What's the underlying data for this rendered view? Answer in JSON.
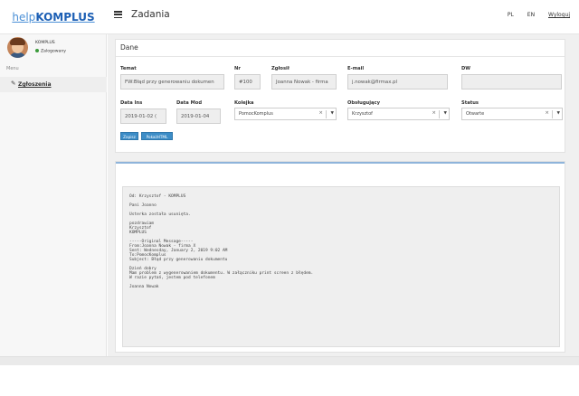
{
  "header": {
    "logo_part1": "help",
    "logo_part2": "KOMPLUS",
    "title": "Zadania",
    "lang_pl": "PL",
    "lang_en": "EN",
    "logout": "Wyloguj"
  },
  "sidebar": {
    "user_name": "KOMPLUS",
    "user_status": "Zalogowany",
    "menu_header": "Menu",
    "items": [
      {
        "label": "Zgłoszenia",
        "icon": "edit-icon"
      }
    ]
  },
  "form": {
    "panel_title": "Dane",
    "temat_label": "Temat",
    "temat_value": "FW:Błąd przy generowaniu dokumen",
    "nr_label": "Nr",
    "nr_value": "#100",
    "zglosil_label": "Zgłosił",
    "zglosil_value": "Joanna Nowak - firma",
    "email_label": "E-mail",
    "email_value": "j.nowak@firmax.pl",
    "dw_label": "DW",
    "dw_value": "",
    "data_ins_label": "Data Ins",
    "data_ins_value": "2019-01-02 (",
    "data_mod_label": "Data Mod",
    "data_mod_value": "2019-01-04",
    "kolejka_label": "Kolejka",
    "kolejka_value": "PomocKomplus",
    "obslugujacy_label": "Obsługujący",
    "obslugujacy_value": "Krzysztof",
    "status_label": "Status",
    "status_value": "Otwarte",
    "save_button": "Zapisz",
    "html_button": "PokażHTML"
  },
  "message": {
    "lines": [
      "Od: Krzysztof - KOMPLUS",
      "",
      "Pani Joanno",
      "",
      "Usterka została usunięta.",
      "",
      "pozdrawiam",
      "Krzysztof",
      "KOMPLUS",
      "",
      "-----Original Message-----",
      "From:Joanna Nowak - firma X",
      "Sent: Wednesday, January 2, 2019 9:02 AM",
      "To:PomocKomplus",
      "Subject: Błąd przy generowaniu dokumentu",
      "",
      "Dzień dobry",
      "Mam problem z wygenerowaniem dokumentu. W załączniku print screen z błędem.",
      "W razie pytań, jestem pod telefonem",
      "",
      "Joanna Nowak"
    ]
  }
}
